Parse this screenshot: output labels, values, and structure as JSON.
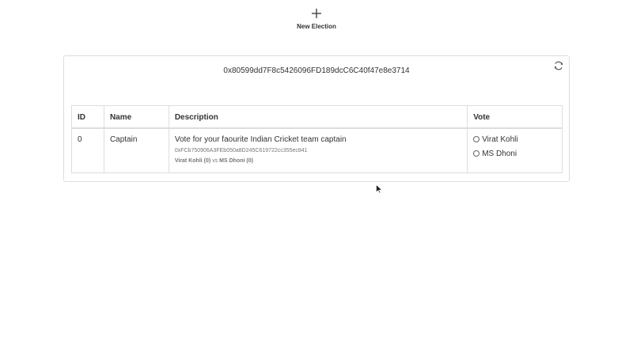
{
  "toolbar": {
    "new_election_label": "New Election",
    "new_election_icon": "plus-icon"
  },
  "card": {
    "contract_address": "0x80599dd7F8c5426096FD189dcC6C40f47e8e3714",
    "refresh_icon": "refresh-icon"
  },
  "table": {
    "headers": {
      "id": "ID",
      "name": "Name",
      "description": "Description",
      "vote": "Vote"
    },
    "rows": [
      {
        "id": "0",
        "name": "Captain",
        "description": "Vote for your faourite Indian Cricket team captain",
        "contract": "0xFCb750906A3FEb050a8D245C619722cc355ec841",
        "tally": {
          "candidate1": "Virat Kohli",
          "count1": "(0)",
          "vs": "vs",
          "candidate2": "MS Dhoni",
          "count2": "(0)"
        },
        "options": [
          "Virat Kohli",
          "MS Dhoni"
        ]
      }
    ]
  }
}
